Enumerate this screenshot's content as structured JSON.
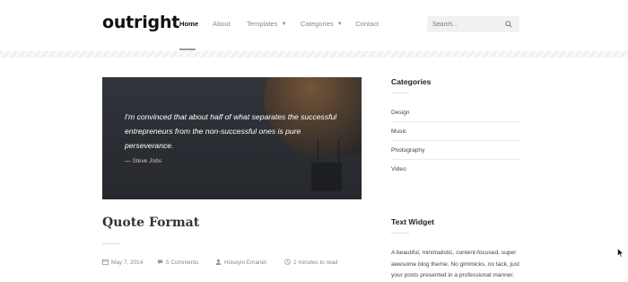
{
  "site": {
    "logo": "outright"
  },
  "nav": {
    "items": [
      {
        "label": "Home",
        "active": true
      },
      {
        "label": "About"
      },
      {
        "label": "Templates",
        "has_dropdown": true
      },
      {
        "label": "Categories",
        "has_dropdown": true
      },
      {
        "label": "Contact"
      }
    ]
  },
  "search": {
    "placeholder": "Search..."
  },
  "hero": {
    "quote": "I'm convinced that about half of what separates the successful entrepreneurs from the non-successful ones is pure perseverance.",
    "author": "— Steve Jobs"
  },
  "post": {
    "title": "Quote Format",
    "date": "May 7, 2014",
    "comments": "5 Comments",
    "author": "Hüseyin Emanet",
    "read_time": "2 minutes to read"
  },
  "sidebar": {
    "categories_title": "Categories",
    "categories": [
      "Design",
      "Music",
      "Photography",
      "Video"
    ],
    "text_widget_title": "Text Widget",
    "text_widget_body": "A beautiful, minimalistic, content-focused, super awesome blog theme. No gimmicks, no tack, just your posts presented in a professional manner."
  },
  "colors": {
    "active_nav": "#111111",
    "muted_nav": "#8a8a8a",
    "hero_bg": "#2e3036"
  }
}
